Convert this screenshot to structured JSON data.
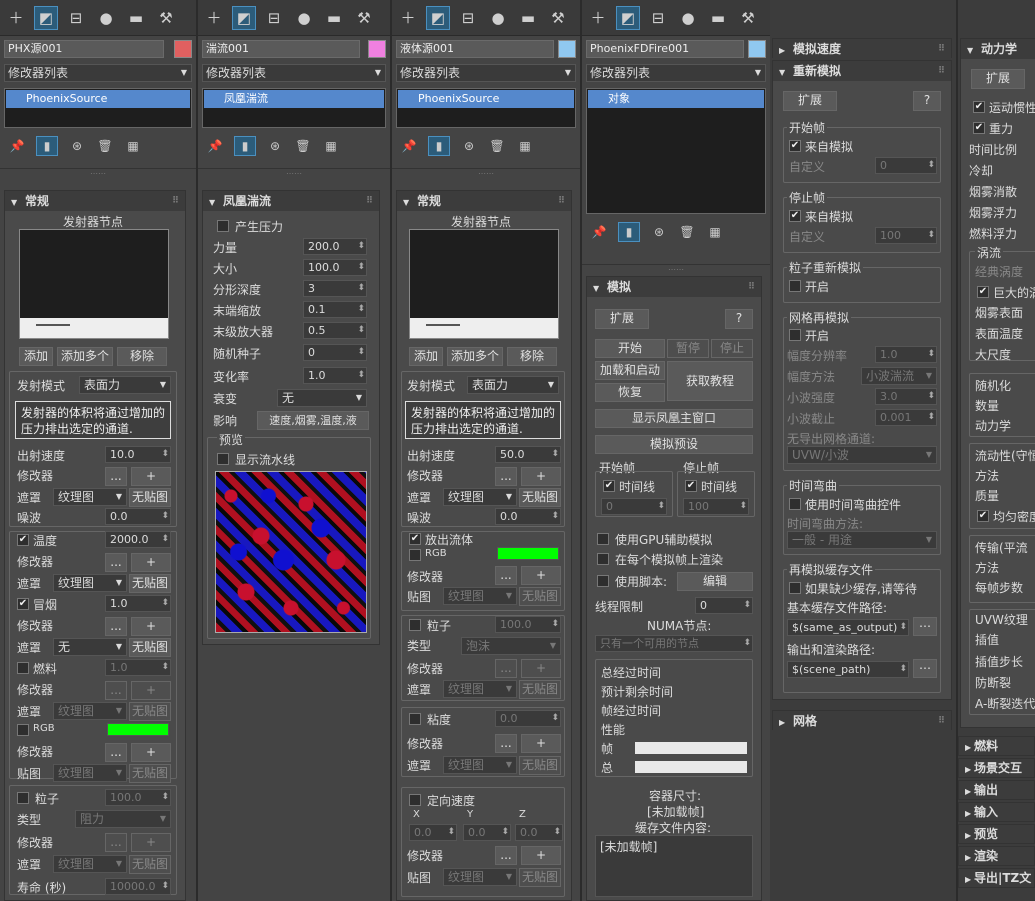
{
  "toolbar_icons": [
    "plus-icon",
    "modify-icon",
    "hierarchy-icon",
    "motion-icon",
    "display-icon",
    "utilities-icon"
  ],
  "p1": {
    "name": "PHX源001",
    "color": "#e06060",
    "modlist": "修改器列表",
    "stack": [
      "PhoenixSource"
    ],
    "roll": "常规",
    "emitter_node": "发射器节点",
    "add": "添加",
    "add_multi": "添加多个",
    "remove": "移除",
    "emit_mode_lbl": "发射模式",
    "emit_mode": "表面力",
    "info": "发射器的体积将通过增加的压力排出选定的通道.",
    "out_speed_lbl": "出射速度",
    "out_speed": "10.0",
    "modifier": "修改器",
    "dots": "...",
    "plus": "+",
    "mask": "遮罩",
    "tex_map": "纹理图",
    "no_map": "无贴图",
    "noise_lbl": "噪波",
    "noise": "0.0",
    "temp_lbl": "温度",
    "temp": "2000.0",
    "smoke_lbl": "冒烟",
    "smoke": "1.0",
    "none": "无",
    "fuel_lbl": "燃料",
    "fuel": "1.0",
    "rgb": "RGB",
    "rgb_color": "#00ff00",
    "map_lbl": "贴图",
    "particle_lbl": "粒子",
    "particle": "100.0",
    "type_lbl": "类型",
    "type": "阻力",
    "life_lbl": "寿命 (秒)",
    "life": "10000.0"
  },
  "p2": {
    "name": "湍流001",
    "color": "#f080e0",
    "modlist": "修改器列表",
    "stack": [
      "凤凰湍流"
    ],
    "roll": "凤凰湍流",
    "gen_pressure": "产生压力",
    "rows": [
      [
        "力量",
        "200.0"
      ],
      [
        "大小",
        "100.0"
      ],
      [
        "分形深度",
        "3"
      ],
      [
        "末端缩放",
        "0.1"
      ],
      [
        "末级放大器",
        "0.5"
      ],
      [
        "随机种子",
        "0"
      ],
      [
        "变化率",
        "1.0"
      ]
    ],
    "decay_lbl": "衰变",
    "decay": "无",
    "affect_lbl": "影响",
    "affect": "速度,烟雾,温度,液",
    "preview_lbl": "预览",
    "show_stream": "显示流水线"
  },
  "p3": {
    "name": "液体源001",
    "color": "#90c8f0",
    "modlist": "修改器列表",
    "stack": [
      "PhoenixSource"
    ],
    "roll": "常规",
    "emitter_node": "发射器节点",
    "add": "添加",
    "add_multi": "添加多个",
    "remove": "移除",
    "emit_mode_lbl": "发射模式",
    "emit_mode": "表面力",
    "info": "发射器的体积将通过增加的压力排出选定的通道.",
    "out_speed_lbl": "出射速度",
    "out_speed": "50.0",
    "modifier": "修改器",
    "dots": "...",
    "plus": "+",
    "mask": "遮罩",
    "tex_map": "纹理图",
    "no_map": "无贴图",
    "noise_lbl": "噪波",
    "noise": "0.0",
    "emit_fluid": "放出流体",
    "rgb": "RGB",
    "rgb_color": "#00ff00",
    "map_lbl": "贴图",
    "particle_lbl": "粒子",
    "particle": "100.0",
    "type_lbl": "类型",
    "type": "泡沫",
    "visc_lbl": "粘度",
    "visc": "0.0",
    "dir_speed": "定向速度",
    "x": "X",
    "y": "Y",
    "z": "Z",
    "zero": "0.0"
  },
  "p4": {
    "name": "PhoenixFDFire001",
    "color": "#90c8f0",
    "modlist": "修改器列表",
    "stack": [
      "对象"
    ],
    "roll": "模拟",
    "expand": "扩展",
    "help": "?",
    "start": "开始",
    "pause": "暂停",
    "stop": "停止",
    "load_start": "加载和启动",
    "resume": "恢复",
    "get_tut": "获取教程",
    "show_main": "显示凤凰主窗口",
    "sim_preset": "模拟预设",
    "start_frame": "开始帧",
    "stop_frame": "停止帧",
    "timeline": "时间线",
    "sf": "0",
    "ef": "100",
    "use_gpu": "使用GPU辅助模拟",
    "render_each": "在每个模拟帧上渲染",
    "use_script": "使用脚本:",
    "edit": "编辑",
    "thread_lbl": "线程限制",
    "thread": "0",
    "numa_lbl": "NUMA节点:",
    "numa": "只有一个可用的节点",
    "total_time": "总经过时间",
    "remain": "预计剩余时间",
    "frame_time": "帧经过时间",
    "perf": "性能",
    "frame": "帧",
    "total": "总",
    "container": "容器尺寸:",
    "unloaded": "[未加载帧]",
    "cache_content": "缓存文件内容:"
  },
  "p5": {
    "sim_speed": "模拟速度",
    "resim": "重新模拟",
    "expand": "扩展",
    "help": "?",
    "start_grp": "开始帧",
    "from_sim": "来自模拟",
    "custom": "自定义",
    "start_val": "0",
    "stop_grp": "停止帧",
    "stop_val": "100",
    "particle_resim": "粒子重新模拟",
    "enable": "开启",
    "grid_resim": "网格再模拟",
    "amp_res": "幅度分辨率",
    "amp_res_val": "1.0",
    "amp_method": "幅度方法",
    "amp_method_val": "小波湍流",
    "wave_str": "小波强度",
    "wave_str_val": "3.0",
    "wave_cut": "小波截止",
    "wave_cut_val": "0.001",
    "no_out": "无导出网格通道:",
    "uvw": "UVW/小波",
    "timebend": "时间弯曲",
    "use_timebend": "使用时间弯曲控件",
    "timebend_method": "时间弯曲方法:",
    "timebend_val": "一般 - 用途",
    "resim_cache": "再模拟缓存文件",
    "if_missing": "如果缺少缓存,请等待",
    "base_path": "基本缓存文件路径:",
    "base_val": "$(same_as_output)",
    "out_path": "输出和渲染路径:",
    "out_val": "$(scene_path)",
    "grid": "网格"
  },
  "p6": {
    "dynamics": "动力学",
    "expand": "扩展",
    "motion_inertia": "运动惯性",
    "gravity": "重力",
    "time_scale": "时间比例",
    "cool": "冷却",
    "smoke_diss": "烟雾消散",
    "smoke_buoy": "烟雾浮力",
    "fuel_buoy": "燃料浮力",
    "vortex": "涡流",
    "classic": "经典涡度",
    "huge": "巨大的涡",
    "smoke_surface": "烟雾表面",
    "surface_temp": "表面温度",
    "big_scale": "大尺度",
    "randomize": "随机化",
    "amount": "数量",
    "dyn": "动力学",
    "flowability": "流动性(守恒",
    "method": "方法",
    "quality": "质量",
    "uniform": "均匀密度",
    "transport": "传输(平流",
    "method2": "方法",
    "steps": "每帧步数",
    "uvw_tex": "UVW纹理",
    "interp": "插值",
    "interp_step": "插值步长",
    "anti_break": "防断裂",
    "a_break": "A-断裂迭代",
    "sections": [
      "燃料",
      "场景交互",
      "输出",
      "输入",
      "预览",
      "渲染",
      "导出|TZ文"
    ]
  }
}
